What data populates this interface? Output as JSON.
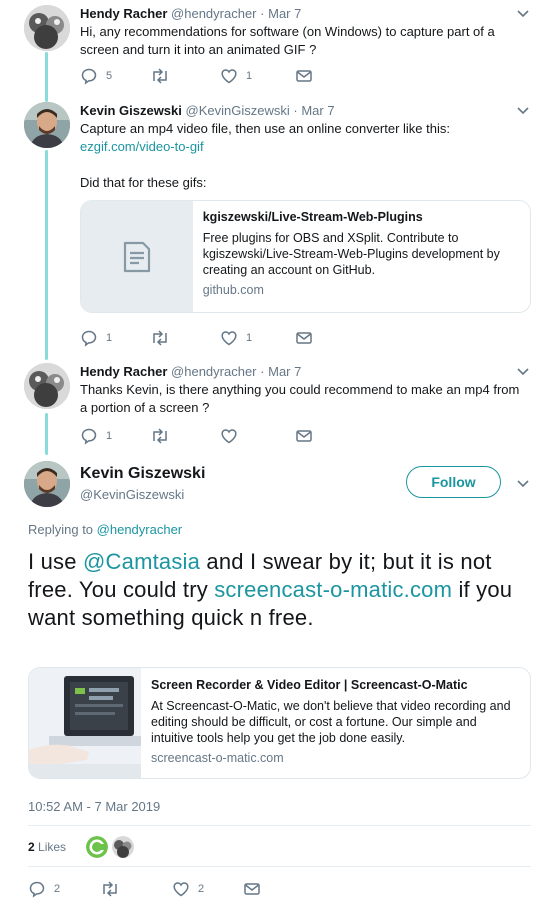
{
  "reply1": {
    "display_name": "Hendy Racher",
    "handle": "@hendyracher",
    "sep": "·",
    "date": "Mar 7",
    "text": "Hi, any recommendations for software (on Windows) to capture part of a screen and turn it into an animated GIF ?",
    "replies": "5",
    "retweets": "",
    "likes": "1"
  },
  "reply2": {
    "display_name": "Kevin Giszewski",
    "handle": "@KevinGiszewski",
    "sep": "·",
    "date": "Mar 7",
    "text_line1": "Capture an mp4 video file, then use an online converter like this:",
    "link": "ezgif.com/video-to-gif",
    "text_line2": "Did that for these gifs:",
    "card": {
      "title": "kgiszewski/Live-Stream-Web-Plugins",
      "description": "Free plugins for OBS and XSplit. Contribute to kgiszewski/Live-Stream-Web-Plugins development by creating an account on GitHub.",
      "url": "github.com"
    },
    "replies": "1",
    "retweets": "",
    "likes": "1"
  },
  "reply3": {
    "display_name": "Hendy Racher",
    "handle": "@hendyracher",
    "sep": "·",
    "date": "Mar 7",
    "text": "Thanks Kevin, is there anything you could recommend to make an mp4 from a portion of a screen ?",
    "replies": "1",
    "retweets": "",
    "likes": ""
  },
  "main": {
    "display_name": "Kevin Giszewski",
    "handle": "@KevinGiszewski",
    "follow_label": "Follow",
    "replying_prefix": "Replying to",
    "replying_handle": "@hendyracher",
    "text_part1": "I use ",
    "mention": "@Camtasia",
    "text_part2": " and I swear by it; but it is not free. You could try ",
    "link": "screencast-o-matic.com",
    "text_part3": " if you want something quick n free.",
    "card": {
      "title": "Screen Recorder & Video Editor | Screencast-O-Matic",
      "description": "At Screencast-O-Matic, we don't believe that video recording and editing should be difficult, or cost a fortune. Our simple and intuitive tools help you get the job done easily.",
      "url": "screencast-o-matic.com"
    },
    "timestamp": "10:52 AM - 7 Mar 2019",
    "likes_count": "2",
    "likes_label": "Likes",
    "replies": "2",
    "retweets": "",
    "likes": "2"
  },
  "colors": {
    "accent": "#1b95a0",
    "thread_line": "#89dcd9",
    "muted": "#657786",
    "border": "#e1e8ed"
  }
}
